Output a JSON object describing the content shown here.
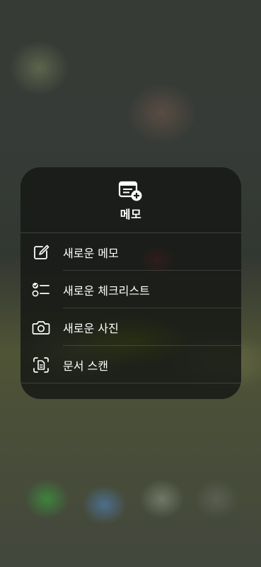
{
  "quick_actions": {
    "app_title": "메모",
    "app_icon": "notes-add-icon",
    "items": [
      {
        "label": "새로운 메모",
        "icon": "compose-icon"
      },
      {
        "label": "새로운 체크리스트",
        "icon": "checklist-icon"
      },
      {
        "label": "새로운 사진",
        "icon": "camera-icon"
      },
      {
        "label": "문서 스캔",
        "icon": "scan-document-icon"
      }
    ]
  },
  "colors": {
    "menu_background": "#16181499",
    "text": "#ffffff",
    "divider": "#ffffff29"
  }
}
